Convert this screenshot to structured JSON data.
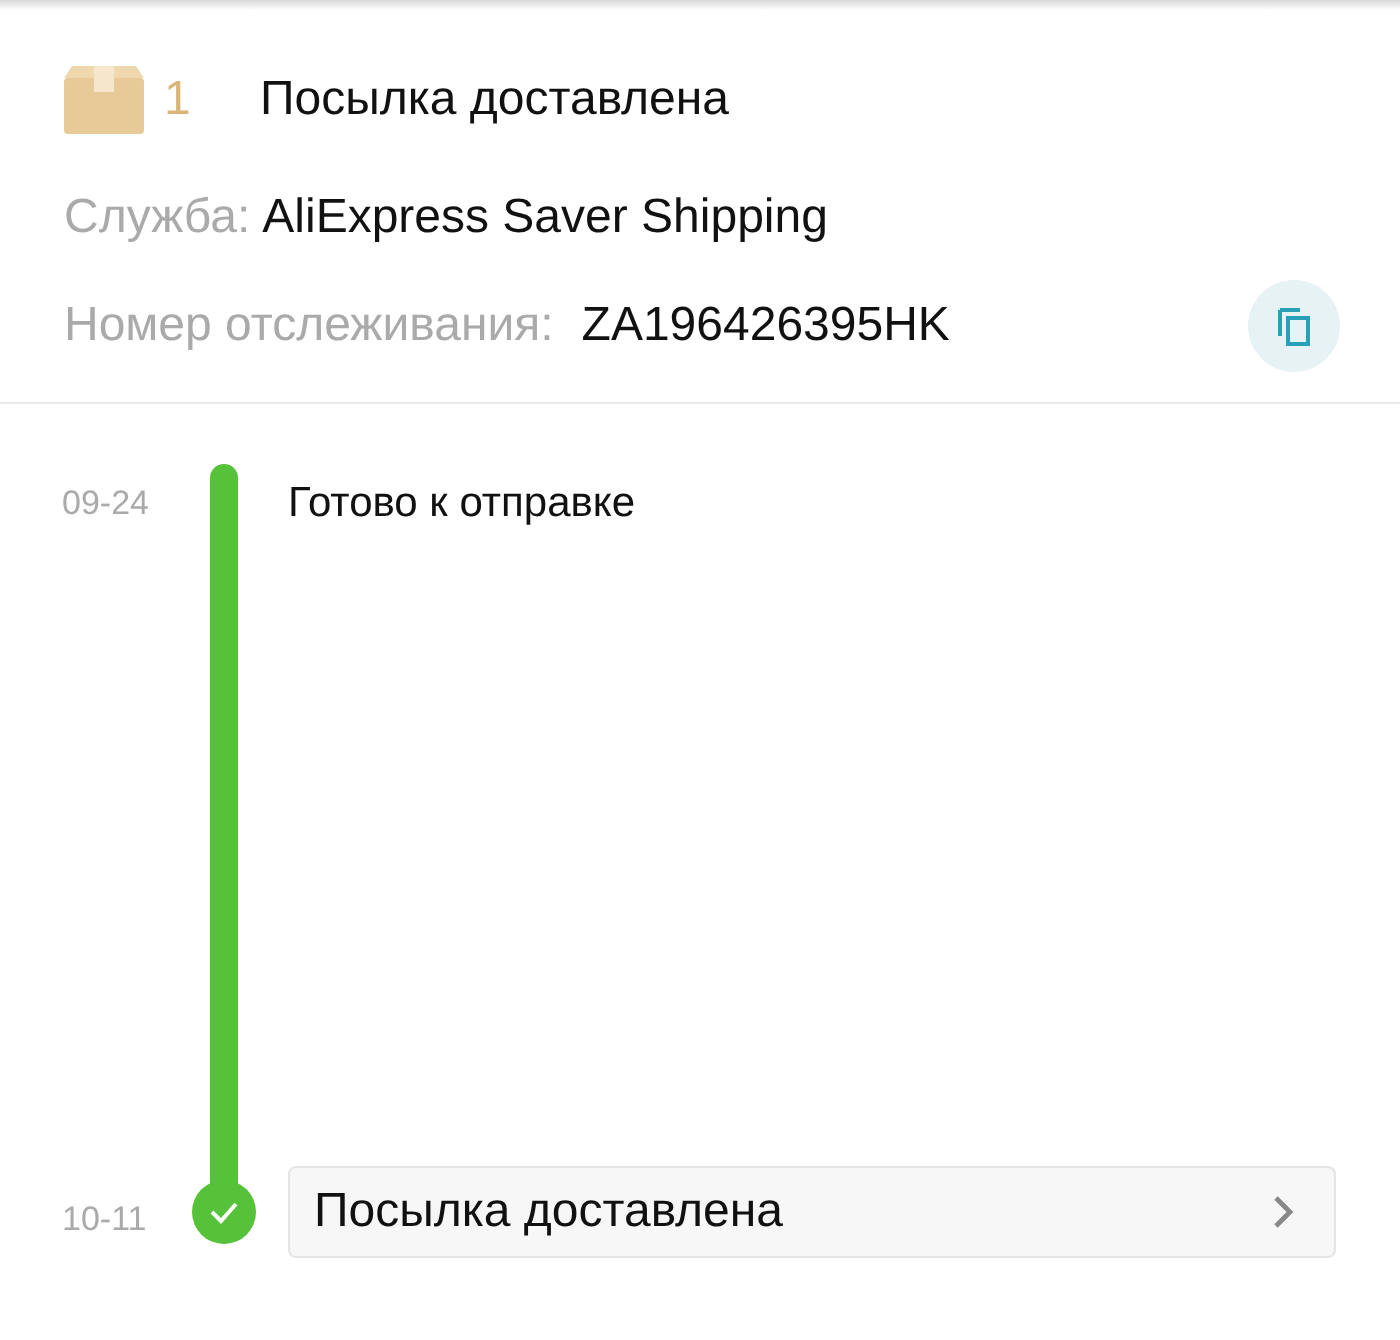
{
  "package": {
    "count": "1",
    "status": "Посылка доставлена"
  },
  "service": {
    "label": "Служба:",
    "value": "AliExpress Saver Shipping"
  },
  "tracking": {
    "label": "Номер отслеживания:",
    "value": "ZA196426395HK"
  },
  "events": [
    {
      "kind": "plain",
      "date": "09-24",
      "text": "Готово к отправке"
    },
    {
      "kind": "card",
      "date": "10-11",
      "text": "Посылка доставлена"
    }
  ]
}
